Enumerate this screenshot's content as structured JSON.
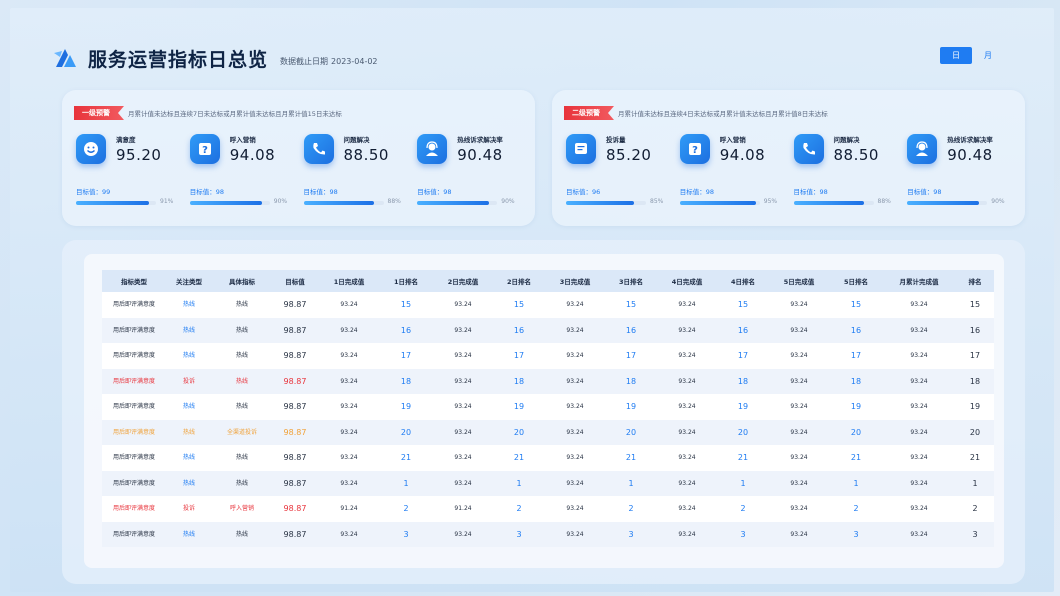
{
  "header": {
    "title": "服务运营指标日总览",
    "date_label": "数据截止日期",
    "date_value": "2023-04-02",
    "toggle": [
      {
        "label": "日",
        "active": true
      },
      {
        "label": "月",
        "active": false
      }
    ]
  },
  "panels": [
    {
      "badge": "一级预警",
      "text": "月累计值未达标且连续7日未达标或月累计值未达标且月累计值15日未达标",
      "metrics": [
        {
          "name": "满意度",
          "value": "95.20",
          "icon": "smile-icon",
          "target": "目标值：99",
          "percent": "91%",
          "fill": 0.91
        },
        {
          "name": "呼入营销",
          "value": "94.08",
          "icon": "question-icon",
          "target": "目标值：98",
          "percent": "90%",
          "fill": 0.9
        },
        {
          "name": "问题解决",
          "value": "88.50",
          "icon": "phone-icon",
          "target": "目标值：98",
          "percent": "88%",
          "fill": 0.88
        },
        {
          "name": "热线诉求解决率",
          "value": "90.48",
          "icon": "headset-icon",
          "target": "目标值：98",
          "percent": "90%",
          "fill": 0.9
        }
      ]
    },
    {
      "badge": "二级预警",
      "text": "月累计值未达标且连续4日未达标或月累计值未达标且月累计值8日未达标",
      "metrics": [
        {
          "name": "投诉量",
          "value": "85.20",
          "icon": "message-icon",
          "target": "目标值：96",
          "percent": "85%",
          "fill": 0.85
        },
        {
          "name": "呼入营销",
          "value": "94.08",
          "icon": "question-icon",
          "target": "目标值：98",
          "percent": "95%",
          "fill": 0.95
        },
        {
          "name": "问题解决",
          "value": "88.50",
          "icon": "phone-icon",
          "target": "目标值：98",
          "percent": "88%",
          "fill": 0.88
        },
        {
          "name": "热线诉求解决率",
          "value": "90.48",
          "icon": "headset-icon",
          "target": "目标值：98",
          "percent": "90%",
          "fill": 0.9
        }
      ]
    }
  ],
  "table": {
    "columns": [
      "指标类型",
      "关注类型",
      "具体指标",
      "目标值",
      "1日完成值",
      "1日排名",
      "2日完成值",
      "2日排名",
      "3日完成值",
      "3日排名",
      "4日完成值",
      "4日排名",
      "5日完成值",
      "5日排名",
      "月累计完成值",
      "排名"
    ],
    "rows": [
      {
        "style": "normal",
        "cells": [
          "用后即评满意度",
          "热线",
          "热线",
          "98.87",
          "93.24",
          "15",
          "93.24",
          "15",
          "93.24",
          "15",
          "93.24",
          "15",
          "93.24",
          "15",
          "93.24",
          "15"
        ]
      },
      {
        "style": "normal",
        "cells": [
          "用后即评满意度",
          "热线",
          "热线",
          "98.87",
          "93.24",
          "16",
          "93.24",
          "16",
          "93.24",
          "16",
          "93.24",
          "16",
          "93.24",
          "16",
          "93.24",
          "16"
        ]
      },
      {
        "style": "normal",
        "cells": [
          "用后即评满意度",
          "热线",
          "热线",
          "98.87",
          "93.24",
          "17",
          "93.24",
          "17",
          "93.24",
          "17",
          "93.24",
          "17",
          "93.24",
          "17",
          "93.24",
          "17"
        ]
      },
      {
        "style": "red",
        "cells": [
          "用后即评满意度",
          "投诉",
          "热线",
          "98.87",
          "93.24",
          "18",
          "93.24",
          "18",
          "93.24",
          "18",
          "93.24",
          "18",
          "93.24",
          "18",
          "93.24",
          "18"
        ]
      },
      {
        "style": "normal",
        "cells": [
          "用后即评满意度",
          "热线",
          "热线",
          "98.87",
          "93.24",
          "19",
          "93.24",
          "19",
          "93.24",
          "19",
          "93.24",
          "19",
          "93.24",
          "19",
          "93.24",
          "19"
        ]
      },
      {
        "style": "orange",
        "cells": [
          "用后即评满意度",
          "热线",
          "全渠道投诉",
          "98.87",
          "93.24",
          "20",
          "93.24",
          "20",
          "93.24",
          "20",
          "93.24",
          "20",
          "93.24",
          "20",
          "93.24",
          "20"
        ]
      },
      {
        "style": "normal",
        "cells": [
          "用后即评满意度",
          "热线",
          "热线",
          "98.87",
          "93.24",
          "21",
          "93.24",
          "21",
          "93.24",
          "21",
          "93.24",
          "21",
          "93.24",
          "21",
          "93.24",
          "21"
        ]
      },
      {
        "style": "normal",
        "cells": [
          "用后即评满意度",
          "热线",
          "热线",
          "98.87",
          "93.24",
          "1",
          "93.24",
          "1",
          "93.24",
          "1",
          "93.24",
          "1",
          "93.24",
          "1",
          "93.24",
          "1"
        ]
      },
      {
        "style": "red",
        "cells": [
          "用后即评满意度",
          "投诉",
          "呼入营销",
          "98.87",
          "91.24",
          "2",
          "91.24",
          "2",
          "93.24",
          "2",
          "93.24",
          "2",
          "93.24",
          "2",
          "93.24",
          "2"
        ]
      },
      {
        "style": "normal",
        "cells": [
          "用后即评满意度",
          "热线",
          "热线",
          "98.87",
          "93.24",
          "3",
          "93.24",
          "3",
          "93.24",
          "3",
          "93.24",
          "3",
          "93.24",
          "3",
          "93.24",
          "3"
        ]
      }
    ]
  }
}
